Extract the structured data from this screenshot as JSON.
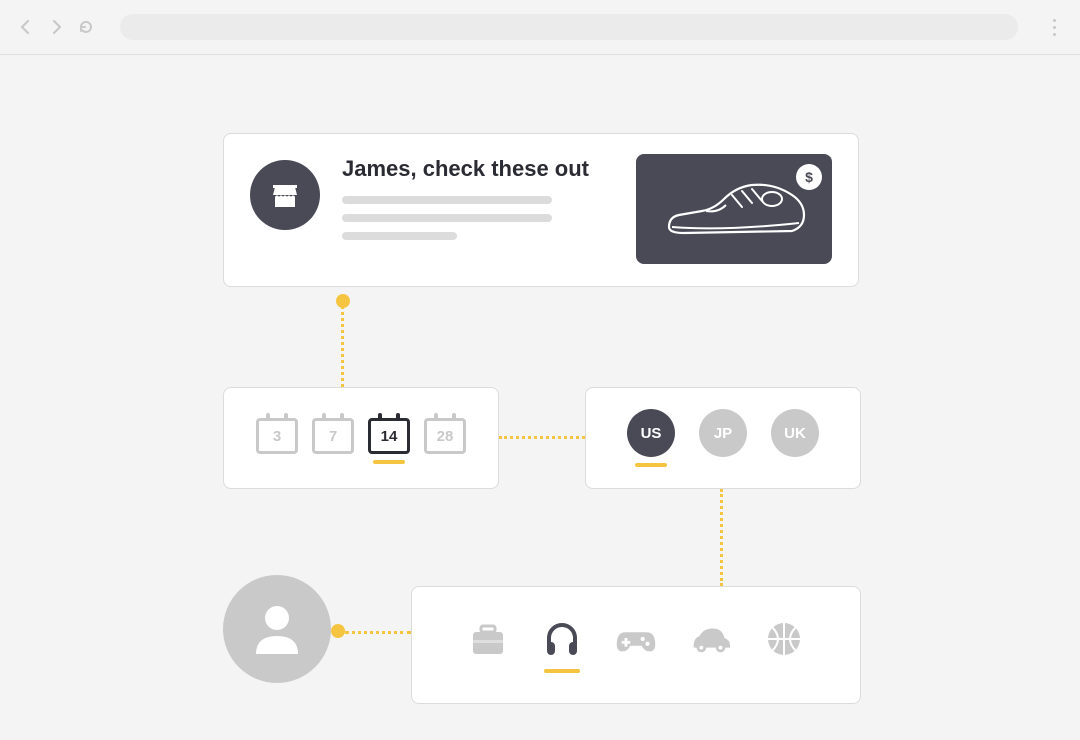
{
  "message": {
    "title": "James, check these out",
    "price_symbol": "$",
    "store_icon": "store-icon",
    "product": "sneaker"
  },
  "calendar": {
    "options": [
      {
        "value": "3",
        "active": false
      },
      {
        "value": "7",
        "active": false
      },
      {
        "value": "14",
        "active": true
      },
      {
        "value": "28",
        "active": false
      }
    ]
  },
  "regions": {
    "options": [
      {
        "code": "US",
        "active": true
      },
      {
        "code": "JP",
        "active": false
      },
      {
        "code": "UK",
        "active": false
      }
    ]
  },
  "interests": {
    "options": [
      {
        "name": "briefcase",
        "active": false
      },
      {
        "name": "headphones",
        "active": true
      },
      {
        "name": "gamepad",
        "active": false
      },
      {
        "name": "car",
        "active": false
      },
      {
        "name": "basketball",
        "active": false
      }
    ]
  }
}
